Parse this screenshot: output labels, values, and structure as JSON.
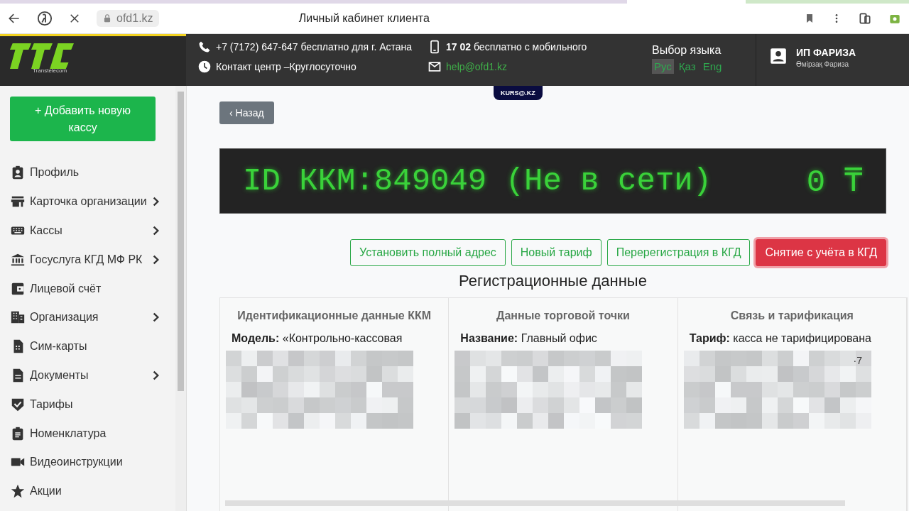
{
  "browser": {
    "url": "ofd1.kz",
    "title": "Личный кабинет клиента",
    "loading": true
  },
  "header": {
    "brand": "Transtelecom",
    "phone": "+7 (7172) 647-647 бесплатно для г. Астана",
    "mobile_bold": "17 02",
    "mobile": "бесплатно с мобильного",
    "contact": "Контакт центр –Круглосуточно",
    "email": "help@ofd1.kz",
    "language_label": "Выбор языка",
    "languages": [
      {
        "label": "Рус",
        "selected": true
      },
      {
        "label": "Қаз",
        "selected": false
      },
      {
        "label": "Eng",
        "selected": false
      }
    ],
    "user_name": "ИП ФАРИЗА",
    "user_sub": "Өмірзақ Фариза"
  },
  "badge": "KURS@.KZ",
  "sidebar": {
    "add_button": "+ Добавить новую кассу",
    "items": [
      {
        "label": "Профиль",
        "submenu": false
      },
      {
        "label": "Карточка организации",
        "submenu": true
      },
      {
        "label": "Кассы",
        "submenu": true
      },
      {
        "label": "Госуслуга КГД МФ РК",
        "submenu": true
      },
      {
        "label": "Лицевой счёт",
        "submenu": false
      },
      {
        "label": "Организация",
        "submenu": true
      },
      {
        "label": "Сим-карты",
        "submenu": false
      },
      {
        "label": "Документы",
        "submenu": true
      },
      {
        "label": "Тарифы",
        "submenu": false
      },
      {
        "label": "Номенклатура",
        "submenu": false
      },
      {
        "label": "Видеоинструкции",
        "submenu": false
      },
      {
        "label": "Акции",
        "submenu": false
      }
    ]
  },
  "back_button": "‹ Назад",
  "display": {
    "text": "ID ККМ:849049 (Не в сети)",
    "amount": "0 ₸"
  },
  "actions": [
    {
      "label": "Установить полный адрес",
      "kind": "outline"
    },
    {
      "label": "Новый тариф",
      "kind": "outline"
    },
    {
      "label": "Перерегистрация в КГД",
      "kind": "outline"
    },
    {
      "label": "Снятие с учёта в КГД",
      "kind": "danger"
    }
  ],
  "section_title": "Регистрационные данные",
  "columns": [
    {
      "title": "Идентификационные данные ККМ",
      "field_label": "Модель:",
      "field_value": "«Контрольно-кассовая"
    },
    {
      "title": "Данные торговой точки",
      "field_label": "Название:",
      "field_value": "Главный офис"
    },
    {
      "title": "Связь и тарификация",
      "field_label": "Тариф:",
      "field_value": "касса не тарифицирована",
      "fragment": "·7"
    }
  ]
}
